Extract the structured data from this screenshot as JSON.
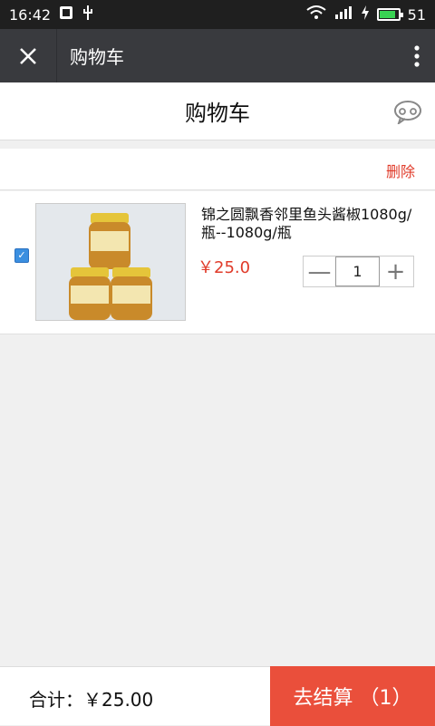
{
  "status_bar": {
    "time": "16:42",
    "signal_label": "¹¹",
    "battery_level": "51",
    "battery_fill": 0.8,
    "battery_color": "#39d353"
  },
  "top_bar": {
    "close_icon": "close-icon",
    "title": "购物车",
    "more_icon": "more-vertical-icon"
  },
  "page": {
    "title": "购物车",
    "chat_icon": "chat-bubble-icon"
  },
  "actions": {
    "delete_label": "删除"
  },
  "cart": {
    "items": [
      {
        "checked": true,
        "name": "锦之圆飘香邻里鱼头酱椒1080g/瓶--1080g/瓶",
        "price": "￥25.0",
        "quantity": "1",
        "minus_label": "—",
        "plus_label": "+",
        "jar_label": "鱼头酱椒"
      }
    ]
  },
  "footer": {
    "total_label": "合计：￥25.00",
    "checkout_label": "去结算 （1）"
  },
  "colors": {
    "accent": "#ea4f3b",
    "price": "#e03b2a",
    "top_bar": "#393a3e",
    "status_bar": "#1f1f1f",
    "checkbox": "#3b8fe0"
  }
}
